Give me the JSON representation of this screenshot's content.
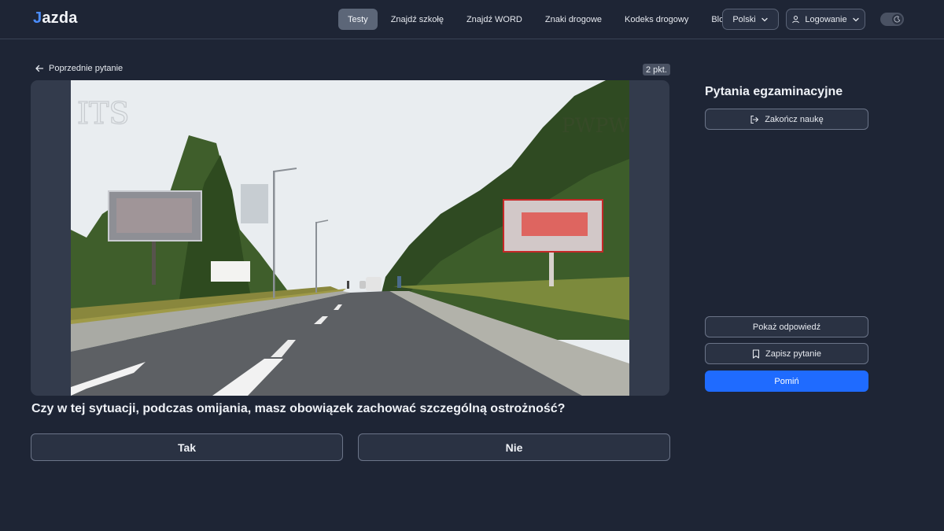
{
  "header": {
    "logo_prefix": "J",
    "logo_text": "azda",
    "nav": [
      {
        "label": "Testy",
        "active": true
      },
      {
        "label": "Znajdź szkołę",
        "active": false
      },
      {
        "label": "Znajdź WORD",
        "active": false
      },
      {
        "label": "Znaki drogowe",
        "active": false
      },
      {
        "label": "Kodeks drogowy",
        "active": false
      },
      {
        "label": "Blog",
        "active": false
      }
    ],
    "language_label": "Polski",
    "login_label": "Logowanie",
    "theme_toggle_icon": "moon-icon"
  },
  "question_nav": {
    "previous_label": "Poprzednie pytanie",
    "points_label": "2 pkt."
  },
  "media": {
    "watermark_left": "ITS",
    "watermark_right": "PWPW"
  },
  "question": {
    "text": "Czy w tej sytuacji, podczas omijania, masz obowiązek zachować szczególną ostrożność?",
    "answers": [
      "Tak",
      "Nie"
    ]
  },
  "sidebar": {
    "title": "Pytania egzaminacyjne",
    "end_label": "Zakończ naukę",
    "show_answer_label": "Pokaż odpowiedź",
    "save_label": "Zapisz pytanie",
    "skip_label": "Pomiń"
  },
  "colors": {
    "background": "#1e2535",
    "accent": "#1f6bff",
    "logo_accent": "#4b8dff"
  }
}
